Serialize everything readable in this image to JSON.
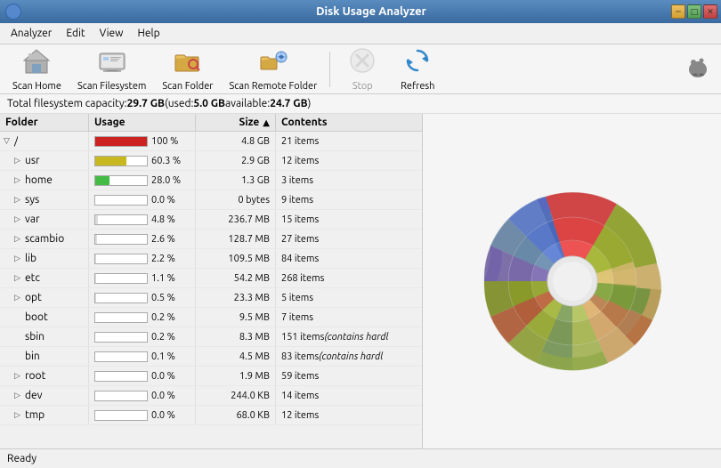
{
  "titlebar": {
    "title": "Disk Usage Analyzer",
    "controls": [
      "minimize",
      "maximize",
      "close"
    ]
  },
  "menubar": {
    "items": [
      "Analyzer",
      "Edit",
      "View",
      "Help"
    ]
  },
  "toolbar": {
    "buttons": [
      {
        "id": "scan-home",
        "label": "Scan Home",
        "icon": "🏠",
        "disabled": false
      },
      {
        "id": "scan-filesystem",
        "label": "Scan Filesystem",
        "icon": "💻",
        "disabled": false
      },
      {
        "id": "scan-folder",
        "label": "Scan Folder",
        "icon": "📂",
        "disabled": false
      },
      {
        "id": "scan-remote",
        "label": "Scan Remote Folder",
        "icon": "🌐",
        "disabled": false
      },
      {
        "id": "stop",
        "label": "Stop",
        "icon": "⊗",
        "disabled": true
      },
      {
        "id": "refresh",
        "label": "Refresh",
        "icon": "↺",
        "disabled": false
      }
    ]
  },
  "fsinfo": {
    "text_before": "Total filesystem capacity: ",
    "capacity": "29.7 GB",
    "text_middle": " (used: ",
    "used": "5.0 GB",
    "text_middle2": " available: ",
    "available": "24.7 GB",
    "text_after": " )"
  },
  "table": {
    "headers": [
      "Folder",
      "Usage",
      "Size",
      "Contents"
    ],
    "rows": [
      {
        "indent": 0,
        "expand": "▽",
        "name": "/",
        "usage_pct": 100,
        "usage_label": "100 %",
        "bar_color": "#cc2222",
        "size": "4.8 GB",
        "contents": "21 items",
        "italic": false
      },
      {
        "indent": 1,
        "expand": "▷",
        "name": "usr",
        "usage_pct": 60,
        "usage_label": "60.3 %",
        "bar_color": "#c8b820",
        "size": "2.9 GB",
        "contents": "12 items",
        "italic": false
      },
      {
        "indent": 1,
        "expand": "▷",
        "name": "home",
        "usage_pct": 28,
        "usage_label": "28.0 %",
        "bar_color": "#44bb44",
        "size": "1.3 GB",
        "contents": "3 items",
        "italic": false
      },
      {
        "indent": 1,
        "expand": "▷",
        "name": "sys",
        "usage_pct": 0,
        "usage_label": "0.0 %",
        "bar_color": "#dddddd",
        "size": "0 bytes",
        "contents": "9 items",
        "italic": false
      },
      {
        "indent": 1,
        "expand": "▷",
        "name": "var",
        "usage_pct": 5,
        "usage_label": "4.8 %",
        "bar_color": "#dddddd",
        "size": "236.7 MB",
        "contents": "15 items",
        "italic": false
      },
      {
        "indent": 1,
        "expand": "▷",
        "name": "scambio",
        "usage_pct": 3,
        "usage_label": "2.6 %",
        "bar_color": "#dddddd",
        "size": "128.7 MB",
        "contents": "27 items",
        "italic": false
      },
      {
        "indent": 1,
        "expand": "▷",
        "name": "lib",
        "usage_pct": 2,
        "usage_label": "2.2 %",
        "bar_color": "#dddddd",
        "size": "109.5 MB",
        "contents": "84 items",
        "italic": false
      },
      {
        "indent": 1,
        "expand": "▷",
        "name": "etc",
        "usage_pct": 1,
        "usage_label": "1.1 %",
        "bar_color": "#dddddd",
        "size": "54.2 MB",
        "contents": "268 items",
        "italic": false
      },
      {
        "indent": 1,
        "expand": "▷",
        "name": "opt",
        "usage_pct": 1,
        "usage_label": "0.5 %",
        "bar_color": "#dddddd",
        "size": "23.3 MB",
        "contents": "5 items",
        "italic": false
      },
      {
        "indent": 1,
        "expand": null,
        "name": "boot",
        "usage_pct": 0,
        "usage_label": "0.2 %",
        "bar_color": "#dddddd",
        "size": "9.5 MB",
        "contents": "7 items",
        "italic": false
      },
      {
        "indent": 1,
        "expand": null,
        "name": "sbin",
        "usage_pct": 0,
        "usage_label": "0.2 %",
        "bar_color": "#dddddd",
        "size": "8.3 MB",
        "contents": "151 items",
        "italic": true,
        "extra": "(contains hardl"
      },
      {
        "indent": 1,
        "expand": null,
        "name": "bin",
        "usage_pct": 0,
        "usage_label": "0.1 %",
        "bar_color": "#dddddd",
        "size": "4.5 MB",
        "contents": "83 items",
        "italic": true,
        "extra": "(contains hardl"
      },
      {
        "indent": 1,
        "expand": "▷",
        "name": "root",
        "usage_pct": 0,
        "usage_label": "0.0 %",
        "bar_color": "#dddddd",
        "size": "1.9 MB",
        "contents": "59 items",
        "italic": false
      },
      {
        "indent": 1,
        "expand": "▷",
        "name": "dev",
        "usage_pct": 0,
        "usage_label": "0.0 %",
        "bar_color": "#dddddd",
        "size": "244.0 KB",
        "contents": "14 items",
        "italic": false
      },
      {
        "indent": 1,
        "expand": "▷",
        "name": "tmp",
        "usage_pct": 0,
        "usage_label": "0.0 %",
        "bar_color": "#dddddd",
        "size": "68.0 KB",
        "contents": "12 items",
        "italic": false
      }
    ]
  },
  "statusbar": {
    "text": "Ready"
  }
}
